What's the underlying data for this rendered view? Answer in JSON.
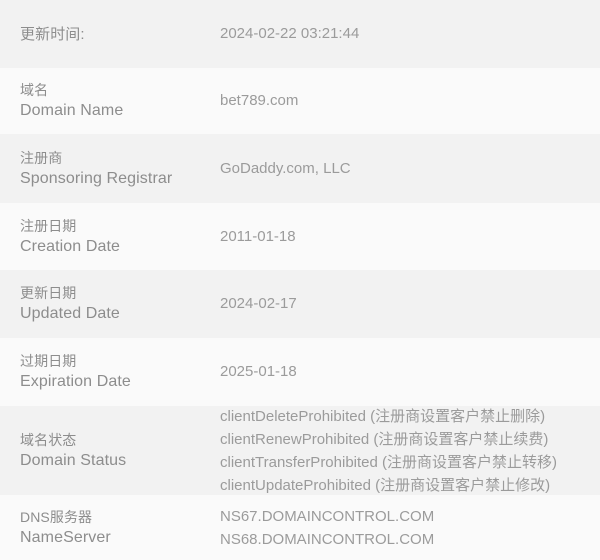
{
  "table": {
    "colors": {
      "row_shade_a": "#f2f2f2",
      "row_shade_b": "#fafafa",
      "label_text": "#8d8d8d",
      "value_text": "#9b9b9b",
      "page_background": "#ffffff"
    },
    "rows": [
      {
        "id": "update-time",
        "label_cn": "更新时间:",
        "label_en": "",
        "values": [
          "2024-02-22 03:21:44"
        ]
      },
      {
        "id": "domain-name",
        "label_cn": "域名",
        "label_en": "Domain Name",
        "values": [
          "bet789.com"
        ]
      },
      {
        "id": "sponsoring-registrar",
        "label_cn": "注册商",
        "label_en": "Sponsoring Registrar",
        "values": [
          "GoDaddy.com, LLC"
        ]
      },
      {
        "id": "creation-date",
        "label_cn": "注册日期",
        "label_en": "Creation Date",
        "values": [
          "2011-01-18"
        ]
      },
      {
        "id": "updated-date",
        "label_cn": "更新日期",
        "label_en": "Updated Date",
        "values": [
          "2024-02-17"
        ]
      },
      {
        "id": "expiration-date",
        "label_cn": "过期日期",
        "label_en": "Expiration Date",
        "values": [
          "2025-01-18"
        ]
      },
      {
        "id": "domain-status",
        "label_cn": "域名状态",
        "label_en": "Domain Status",
        "values": [
          "clientDeleteProhibited (注册商设置客户禁止删除)",
          "clientRenewProhibited (注册商设置客户禁止续费)",
          "clientTransferProhibited (注册商设置客户禁止转移)",
          "clientUpdateProhibited (注册商设置客户禁止修改)"
        ]
      },
      {
        "id": "name-server",
        "label_cn": "DNS服务器",
        "label_en": "NameServer",
        "values": [
          "NS67.DOMAINCONTROL.COM",
          "NS68.DOMAINCONTROL.COM"
        ]
      }
    ]
  }
}
